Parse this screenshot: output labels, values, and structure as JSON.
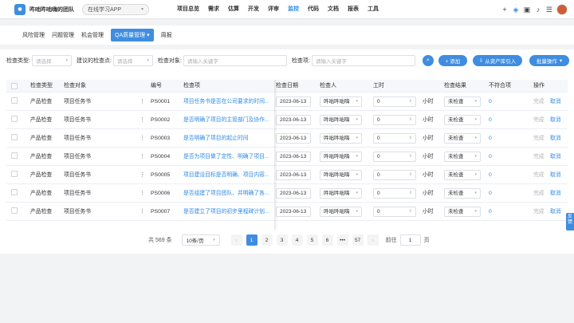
{
  "header": {
    "team_name": "吽咄吽咄嗨的团队",
    "project_select": "在线学习APP",
    "nav": [
      "项目总览",
      "需求",
      "估算",
      "开发",
      "评审",
      "监控",
      "代码",
      "文档",
      "报表",
      "工具"
    ],
    "active_nav": "监控"
  },
  "subtabs": [
    "风险管理",
    "问题管理",
    "机会管理",
    "QA质量管理",
    "周报"
  ],
  "filters": {
    "type_label": "检查类型:",
    "type_placeholder": "请选择",
    "point_label": "建议的检查点:",
    "point_placeholder": "请选择",
    "object_label": "检查对象:",
    "object_placeholder": "请输入关键字",
    "item_label": "检查项:",
    "item_placeholder": "请输入关键字"
  },
  "actions": {
    "add": "+ 添加",
    "import": "从资产库引入",
    "batch": "批量操作"
  },
  "columns": [
    "检查类型",
    "检查对象",
    "编号",
    "检查项",
    "检查日期",
    "检查人",
    "工时",
    "检查结果",
    "不符合项",
    "操作"
  ],
  "rows": [
    {
      "type": "产品检查",
      "object": "项目任务书",
      "id": "PS0001",
      "item": "项目任务书是否在公司要求的时间...",
      "date": "2023-06-13",
      "checker": "吽咄吽咄嗨",
      "hours": "0",
      "unit": "小时",
      "result": "未检查",
      "nc": "0",
      "op1": "完成",
      "op2": "取消"
    },
    {
      "type": "产品检查",
      "object": "项目任务书",
      "id": "PS0002",
      "item": "是否明确了项目的主管部门及协作...",
      "date": "2023-06-13",
      "checker": "吽咄吽咄嗨",
      "hours": "0",
      "unit": "小时",
      "result": "未检查",
      "nc": "0",
      "op1": "完成",
      "op2": "取消"
    },
    {
      "type": "产品检查",
      "object": "项目任务书",
      "id": "PS0003",
      "item": "是否明确了项目的起止时间",
      "date": "2023-06-13",
      "checker": "吽咄吽咄嗨",
      "hours": "0",
      "unit": "小时",
      "result": "未检查",
      "nc": "0",
      "op1": "完成",
      "op2": "取消"
    },
    {
      "type": "产品检查",
      "object": "项目任务书",
      "id": "PS0004",
      "item": "是否为项目做了定性、明确了项目...",
      "date": "2023-06-13",
      "checker": "吽咄吽咄嗨",
      "hours": "0",
      "unit": "小时",
      "result": "未检查",
      "nc": "0",
      "op1": "完成",
      "op2": "取消"
    },
    {
      "type": "产品检查",
      "object": "项目任务书",
      "id": "PS0005",
      "item": "项目建设目标是否明确、项目内容...",
      "date": "2023-06-13",
      "checker": "吽咄吽咄嗨",
      "hours": "0",
      "unit": "小时",
      "result": "未检查",
      "nc": "0",
      "op1": "完成",
      "op2": "取消"
    },
    {
      "type": "产品检查",
      "object": "项目任务书",
      "id": "PS0006",
      "item": "是否组建了项目团队、并明确了各...",
      "date": "2023-06-13",
      "checker": "吽咄吽咄嗨",
      "hours": "0",
      "unit": "小时",
      "result": "未检查",
      "nc": "0",
      "op1": "完成",
      "op2": "取消"
    },
    {
      "type": "产品检查",
      "object": "项目任务书",
      "id": "PS0007",
      "item": "是否建立了项目的初步里程碑计划...",
      "date": "2023-06-13",
      "checker": "吽咄吽咄嗨",
      "hours": "0",
      "unit": "小时",
      "result": "未检查",
      "nc": "0",
      "op1": "完成",
      "op2": "取消"
    }
  ],
  "pagination": {
    "total": "共 569 条",
    "page_size": "10条/页",
    "pages": [
      "1",
      "2",
      "3",
      "4",
      "5",
      "6",
      "•••",
      "57"
    ],
    "current": "1",
    "goto_label": "前往",
    "goto_value": "1",
    "page_suffix": "页"
  },
  "side_tab": "反馈",
  "colors": {
    "accent": "#3f8de0",
    "link": "#2e8ae6"
  }
}
